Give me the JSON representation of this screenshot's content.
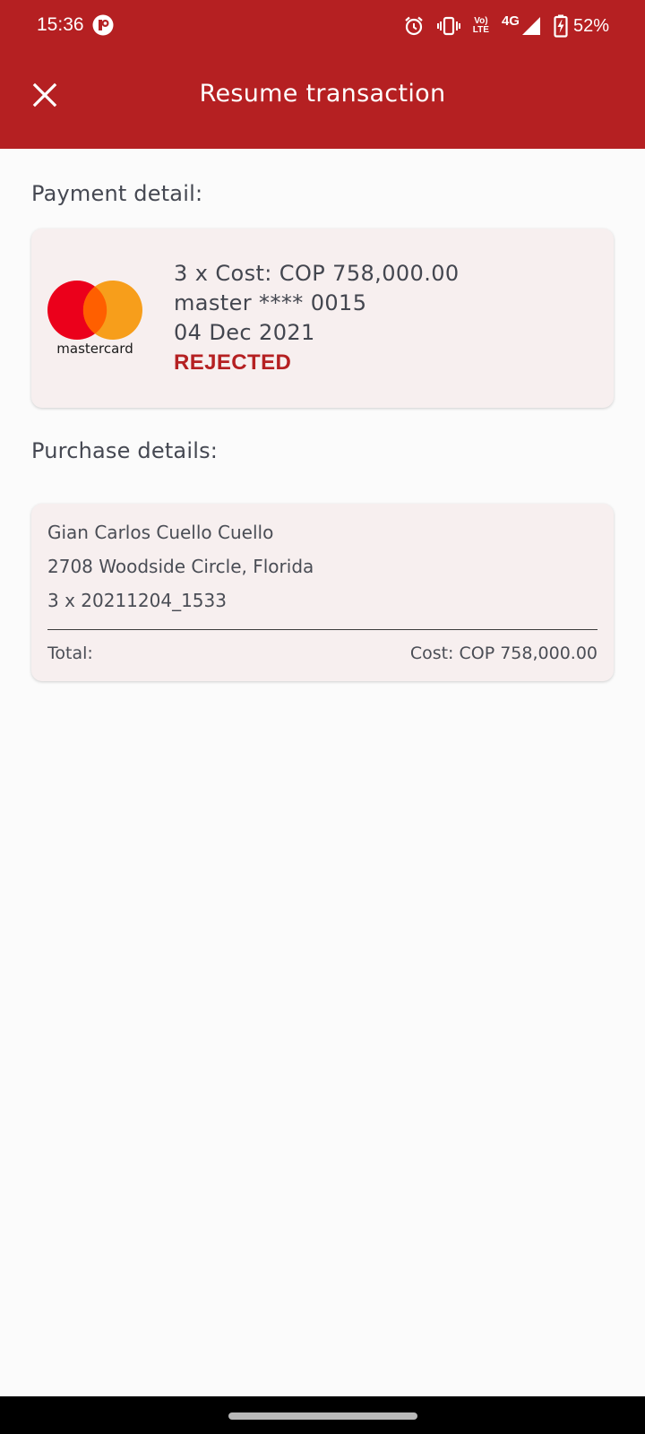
{
  "status_bar": {
    "time": "15:36",
    "network": "4G",
    "battery": "52%",
    "icons": [
      "app-notification-icon",
      "alarm-icon",
      "vibrate-icon",
      "volte-icon",
      "signal-icon",
      "battery-charging-icon"
    ]
  },
  "app_bar": {
    "title": "Resume transaction",
    "close_icon": "close-icon"
  },
  "payment": {
    "section_title": "Payment detail:",
    "brand": "mastercard",
    "cost_line": "3 x Cost: COP 758,000.00",
    "card_line": "master **** 0015",
    "date": "04 Dec 2021",
    "status": "REJECTED"
  },
  "purchase": {
    "section_title": "Purchase details:",
    "name": "Gian Carlos Cuello Cuello",
    "address": "2708 Woodside Circle, Florida",
    "item": "3 x 20211204_1533",
    "total_label": "Total:",
    "total_value": "Cost: COP 758,000.00"
  },
  "colors": {
    "primary": "#b52022",
    "card_bg": "#f7efef",
    "mc_red": "#eb001b",
    "mc_orange": "#f79e1b",
    "mc_overlap": "#ff5f00"
  }
}
